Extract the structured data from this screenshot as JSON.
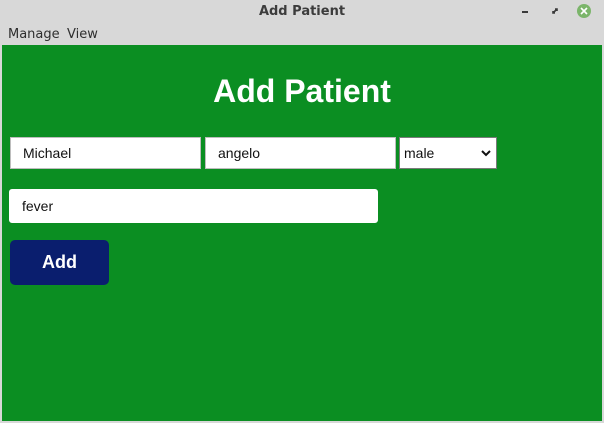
{
  "window": {
    "title": "Add Patient",
    "controls": {
      "minimize_icon": "minimize-icon",
      "maximize_icon": "maximize-icon",
      "close_icon": "close-icon",
      "close_color": "#7bb56a"
    }
  },
  "menubar": {
    "items": [
      {
        "label": "Manage"
      },
      {
        "label": "View"
      }
    ]
  },
  "form": {
    "heading": "Add Patient",
    "first_name": "Michael",
    "last_name": "angelo",
    "gender": "male",
    "reason": "fever",
    "add_label": "Add"
  },
  "colors": {
    "background": "#0b8e22",
    "button": "#0a1e6e"
  }
}
